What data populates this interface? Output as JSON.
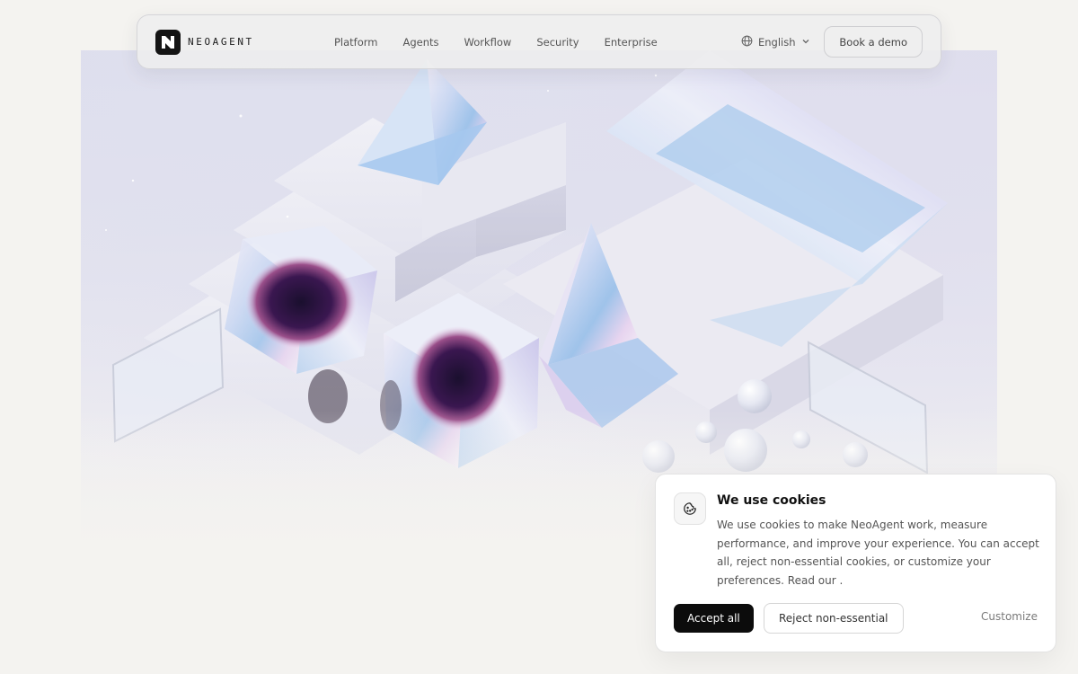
{
  "brand": {
    "name": "NEOAGENT",
    "logo_icon": "neoagent-logo-icon"
  },
  "nav": {
    "links": [
      "Platform",
      "Agents",
      "Workflow",
      "Security",
      "Enterprise"
    ],
    "language": {
      "label": "English",
      "icon": "globe-icon",
      "caret": "chevron-down-icon"
    },
    "cta": "Book a demo"
  },
  "hero": {
    "image": "iridescent-glass-shapes-illustration",
    "colors": {
      "bg": "#dcdcec",
      "glass": "#aac6ea",
      "orb": "#3a1750"
    }
  },
  "cookie_banner": {
    "icon": "cookie-icon",
    "title": "We use cookies",
    "body": "We use cookies to make NeoAgent work, measure performance, and improve your experience. You can accept all, reject non-essential cookies, or customize your preferences. Read our .",
    "accept": "Accept all",
    "reject": "Reject non-essential",
    "customize": "Customize"
  },
  "colors": {
    "page_bg": "#f4f3f0",
    "primary_button": "#0c0c0c",
    "card_bg": "#ffffff"
  }
}
